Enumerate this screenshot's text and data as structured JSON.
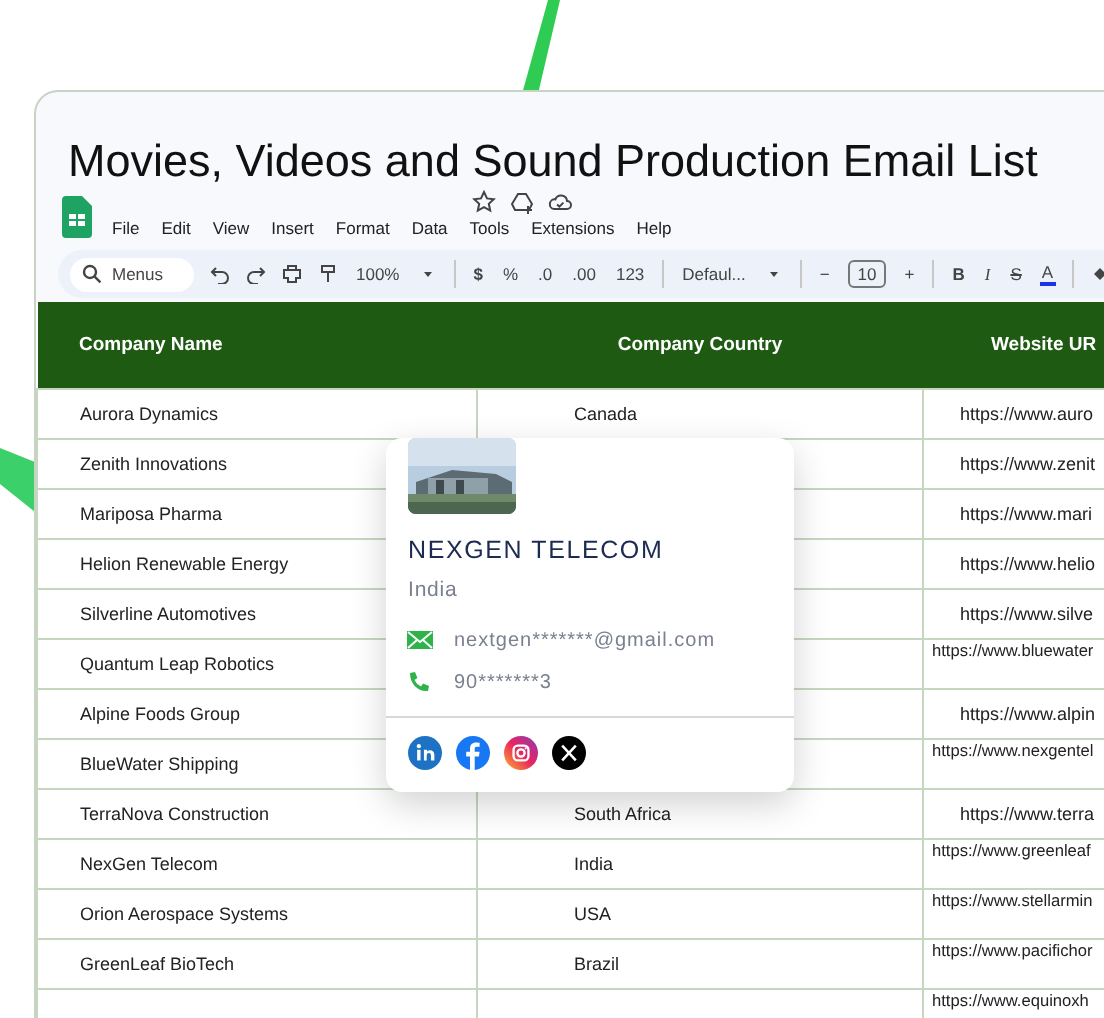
{
  "document": {
    "title": "Movies, Videos and Sound Production Email List"
  },
  "menu": [
    "File",
    "Edit",
    "View",
    "Insert",
    "Format",
    "Data",
    "Tools",
    "Extensions",
    "Help"
  ],
  "toolbar": {
    "search_placeholder": "Menus",
    "zoom": "100%",
    "currency": "$",
    "percent": "%",
    "decimal_decrease": ".0",
    "decimal_increase": ".00",
    "number_format": "123",
    "font": "Defaul...",
    "minus": "−",
    "font_size": "10",
    "plus": "+",
    "bold": "B",
    "italic": "I",
    "strikethrough": "S",
    "text_color": "A"
  },
  "table": {
    "columns": [
      "Company Name",
      "Company Country",
      "Website UR"
    ],
    "rows": [
      {
        "name": "Aurora Dynamics",
        "country": "Canada",
        "website": "https://www.auro",
        "wrapped": false
      },
      {
        "name": "Zenith Innovations",
        "website": "https://www.zenit",
        "wrapped": false
      },
      {
        "name": "Mariposa Pharma",
        "website": "https://www.mari",
        "wrapped": false
      },
      {
        "name": "Helion Renewable Energy",
        "website": "https://www.helio",
        "wrapped": false
      },
      {
        "name": "Silverline Automotives",
        "website": "https://www.silve",
        "wrapped": false
      },
      {
        "name": "Quantum Leap Robotics",
        "website": "https://www.bluewater",
        "wrapped": true
      },
      {
        "name": "Alpine Foods Group",
        "website": "https://www.alpin",
        "wrapped": false
      },
      {
        "name": "BlueWater Shipping",
        "website": "https://www.nexgentel",
        "wrapped": true
      },
      {
        "name": "TerraNova Construction",
        "country": "South Africa",
        "website": "https://www.terra",
        "wrapped": false
      },
      {
        "name": "NexGen Telecom",
        "country": "India",
        "website": "https://www.greenleaf",
        "wrapped": true
      },
      {
        "name": "Orion Aerospace Systems",
        "country": "USA",
        "website": "https://www.stellarmin",
        "wrapped": true
      },
      {
        "name": "GreenLeaf BioTech",
        "country": "Brazil",
        "website": "https://www.pacifichor",
        "wrapped": true
      },
      {
        "website": "https://www.equinoxh",
        "wrapped": true
      }
    ]
  },
  "contact_card": {
    "company": "NEXGEN TELECOM",
    "country": "India",
    "email": "nextgen*******@gmail.com",
    "phone": "90*******3"
  }
}
